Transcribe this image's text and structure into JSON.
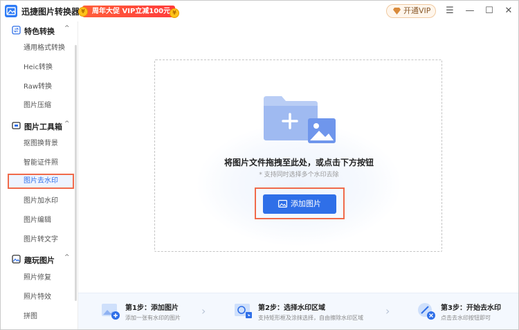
{
  "app": {
    "title": "迅捷图片转换器"
  },
  "promo": {
    "text": "周年大促 VIP立减100元",
    "coin_left": "¥",
    "coin_right": "¥"
  },
  "header": {
    "vip_label": "开通VIP",
    "menu_glyph": "☰",
    "min_glyph": "—",
    "max_glyph": "☐",
    "close_glyph": "✕"
  },
  "sidebar": {
    "groups": [
      {
        "label": "特色转换",
        "chevron": "^",
        "items": [
          "通用格式转换",
          "Heic转换",
          "Raw转换",
          "图片压缩"
        ]
      },
      {
        "label": "图片工具箱",
        "chevron": "^",
        "items": [
          "抠图换背景",
          "智能证件照",
          "图片去水印",
          "图片加水印",
          "图片编辑",
          "图片转文字"
        ]
      },
      {
        "label": "趣玩图片",
        "chevron": "^",
        "items": [
          "照片修复",
          "照片特效",
          "拼图"
        ]
      }
    ],
    "active_item": "图片去水印"
  },
  "dropzone": {
    "title": "将图片文件拖拽至此处，或点击下方按钮",
    "subtitle": "* 支持同时选择多个水印去除",
    "button_label": "添加图片"
  },
  "steps": [
    {
      "title": "第1步：添加图片",
      "desc": "添加一张有水印的图片",
      "icon": "add-image-icon"
    },
    {
      "title": "第2步：选择水印区域",
      "desc": "支持矩形框及涂抹选择，自由擦除水印区域",
      "icon": "select-area-icon"
    },
    {
      "title": "第3步：开始去水印",
      "desc": "点击去水印按钮即可",
      "icon": "remove-watermark-icon"
    }
  ],
  "colors": {
    "accent": "#2f6fe8",
    "highlight_border": "#f06a4a",
    "promo": "#ff4a3a",
    "vip_text": "#8a5a2b"
  }
}
